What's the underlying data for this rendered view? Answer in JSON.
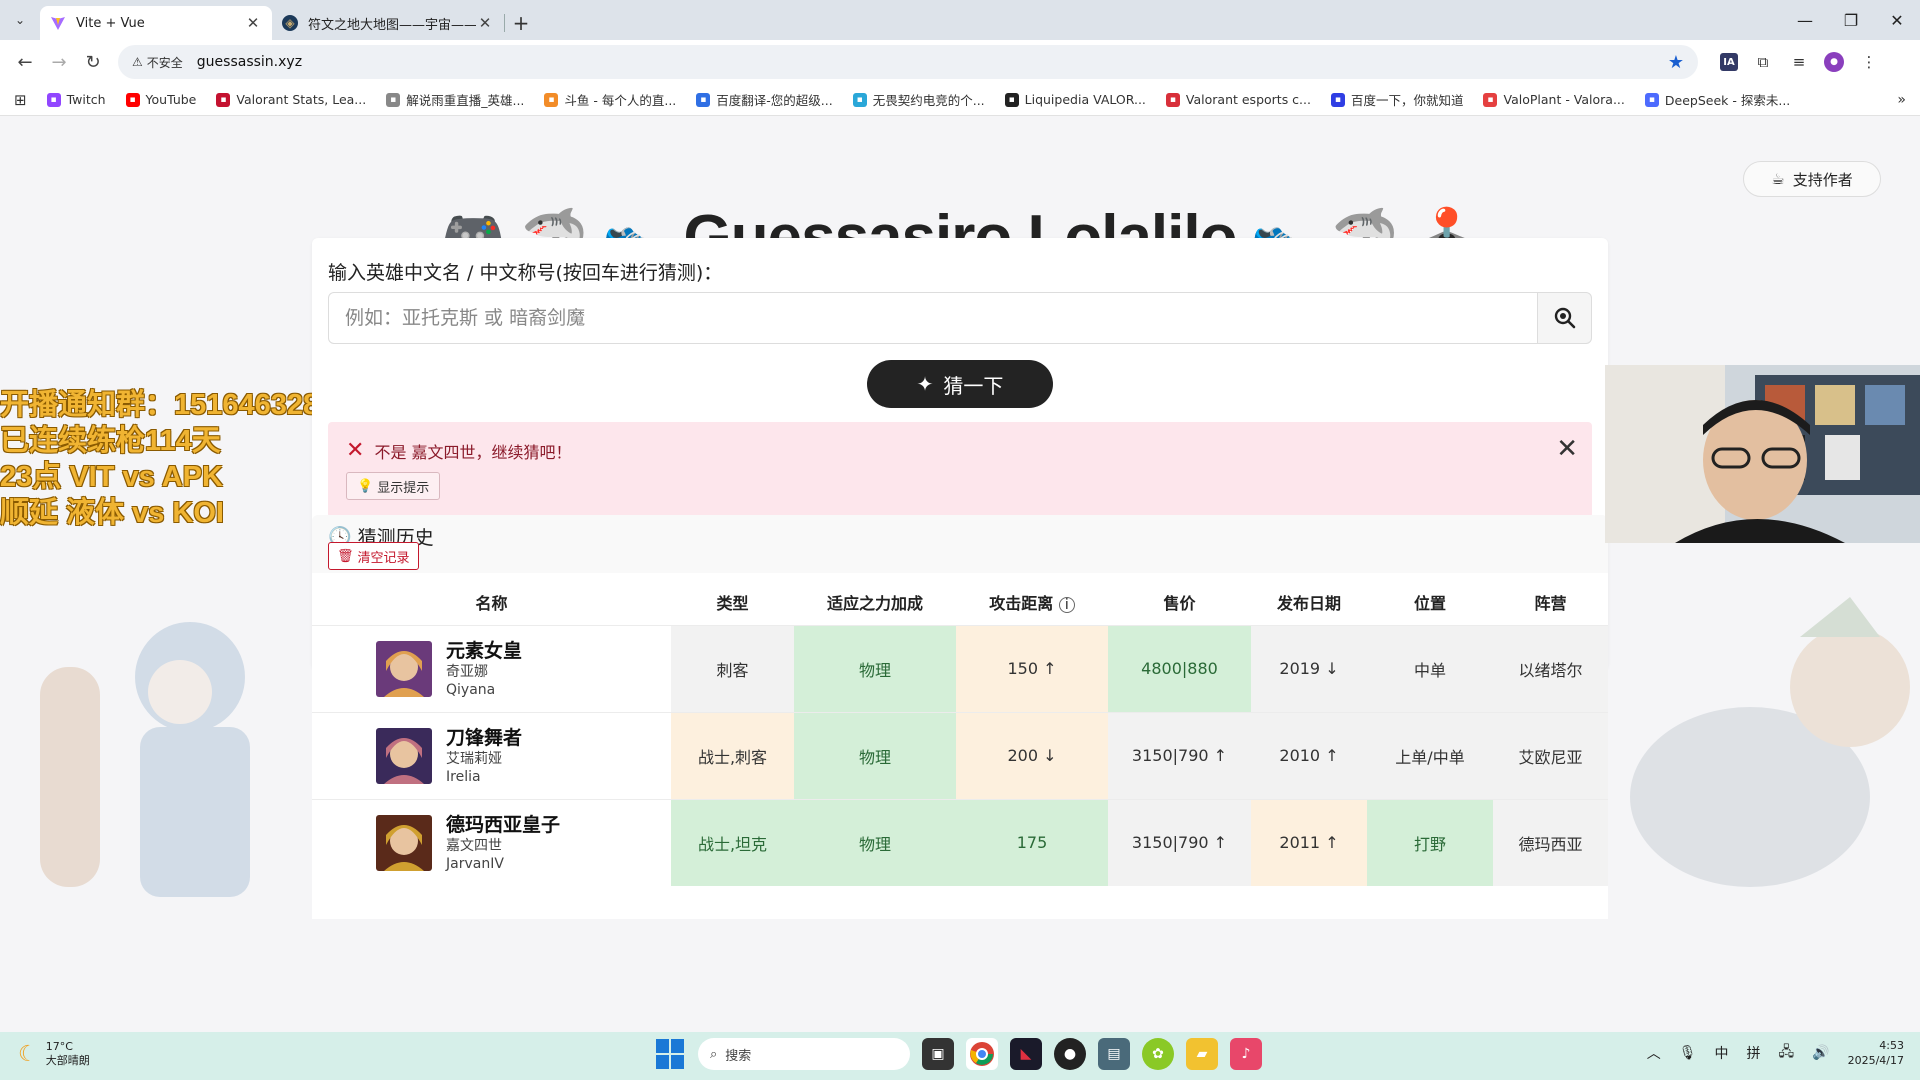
{
  "browser": {
    "tabs": [
      {
        "title": "Vite + Vue",
        "active": true
      },
      {
        "title": "符文之地大地图——宇宙——",
        "active": false
      }
    ],
    "security_label": "不安全",
    "url": "guessassin.xyz",
    "bookmarks": [
      {
        "label": "Twitch",
        "color": "#9146ff"
      },
      {
        "label": "YouTube",
        "color": "#ff0000"
      },
      {
        "label": "Valorant Stats, Lea...",
        "color": "#c41230"
      },
      {
        "label": "解说雨重直播_英雄...",
        "color": "#888888"
      },
      {
        "label": "斗鱼 - 每个人的直...",
        "color": "#f28c28"
      },
      {
        "label": "百度翻译-您的超级...",
        "color": "#2f6fe4"
      },
      {
        "label": "无畏契约电竞的个...",
        "color": "#2aa7d8"
      },
      {
        "label": "Liquipedia VALOR...",
        "color": "#222222"
      },
      {
        "label": "Valorant esports c...",
        "color": "#d82f3a"
      },
      {
        "label": "百度一下，你就知道",
        "color": "#2f3ee4"
      },
      {
        "label": "ValoPlant - Valora...",
        "color": "#e54040"
      },
      {
        "label": "DeepSeek - 探索未...",
        "color": "#4d6bfe"
      }
    ]
  },
  "page": {
    "support_button": "支持作者",
    "title": "Guessasiro Lolalilo",
    "title_emojis_left": [
      "🎮",
      "🦈",
      "👟"
    ],
    "title_emojis_right": [
      "👟",
      "🦈",
      "🕹️"
    ],
    "input_label": "输入英雄中文名 / 中文称号(按回车进行猜测)：",
    "input_placeholder": "例如：亚托克斯 或 暗裔剑魔",
    "input_value": "",
    "guess_button": "猜一下",
    "alert_message": "不是 嘉文四世，继续猜吧！",
    "hint_button": "显示提示",
    "history_title": "猜测历史",
    "clear_button": "清空记录"
  },
  "overlay_lines": [
    "开播通知群：151646328",
    "已连续练枪114天",
    "23点 VIT vs APK",
    "顺延 液体 vs KOI"
  ],
  "table": {
    "headers": [
      "名称",
      "类型",
      "适应之力加成",
      "攻击距离",
      "售价",
      "发布日期",
      "位置",
      "阵营"
    ],
    "rows": [
      {
        "name": "元素女皇",
        "alt": "奇亚娜",
        "en": "Qiyana",
        "type": "刺客",
        "type_state": "gray",
        "adaptive": "物理",
        "adaptive_state": "green",
        "range": "150 ↑",
        "range_state": "yellow",
        "price": "4800|880",
        "price_state": "green",
        "release": "2019 ↓",
        "release_state": "gray",
        "position": "中单",
        "position_state": "gray",
        "faction": "以绪塔尔",
        "faction_state": "gray"
      },
      {
        "name": "刀锋舞者",
        "alt": "艾瑞莉娅",
        "en": "Irelia",
        "type": "战士,刺客",
        "type_state": "yellow",
        "adaptive": "物理",
        "adaptive_state": "green",
        "range": "200 ↓",
        "range_state": "yellow",
        "price": "3150|790 ↑",
        "price_state": "gray",
        "release": "2010 ↑",
        "release_state": "gray",
        "position": "上单/中单",
        "position_state": "gray",
        "faction": "艾欧尼亚",
        "faction_state": "gray"
      },
      {
        "name": "德玛西亚皇子",
        "alt": "嘉文四世",
        "en": "JarvanIV",
        "type": "战士,坦克",
        "type_state": "green",
        "adaptive": "物理",
        "adaptive_state": "green",
        "range": "175",
        "range_state": "green",
        "price": "3150|790 ↑",
        "price_state": "gray",
        "release": "2011 ↑",
        "release_state": "yellow",
        "position": "打野",
        "position_state": "green",
        "faction": "德玛西亚",
        "faction_state": "gray"
      }
    ]
  },
  "taskbar": {
    "weather_temp": "17°C",
    "weather_desc": "大部晴朗",
    "search_placeholder": "搜索",
    "ime1": "中",
    "ime2": "拼",
    "time": "4:53",
    "date": "2025/4/17"
  },
  "colors": {
    "match_green": "#d4efd8",
    "partial_yellow": "#fdf0de",
    "miss_gray": "#f2f2f2",
    "alert_bg": "#fde6ec",
    "overlay_text": "#f0b432"
  }
}
